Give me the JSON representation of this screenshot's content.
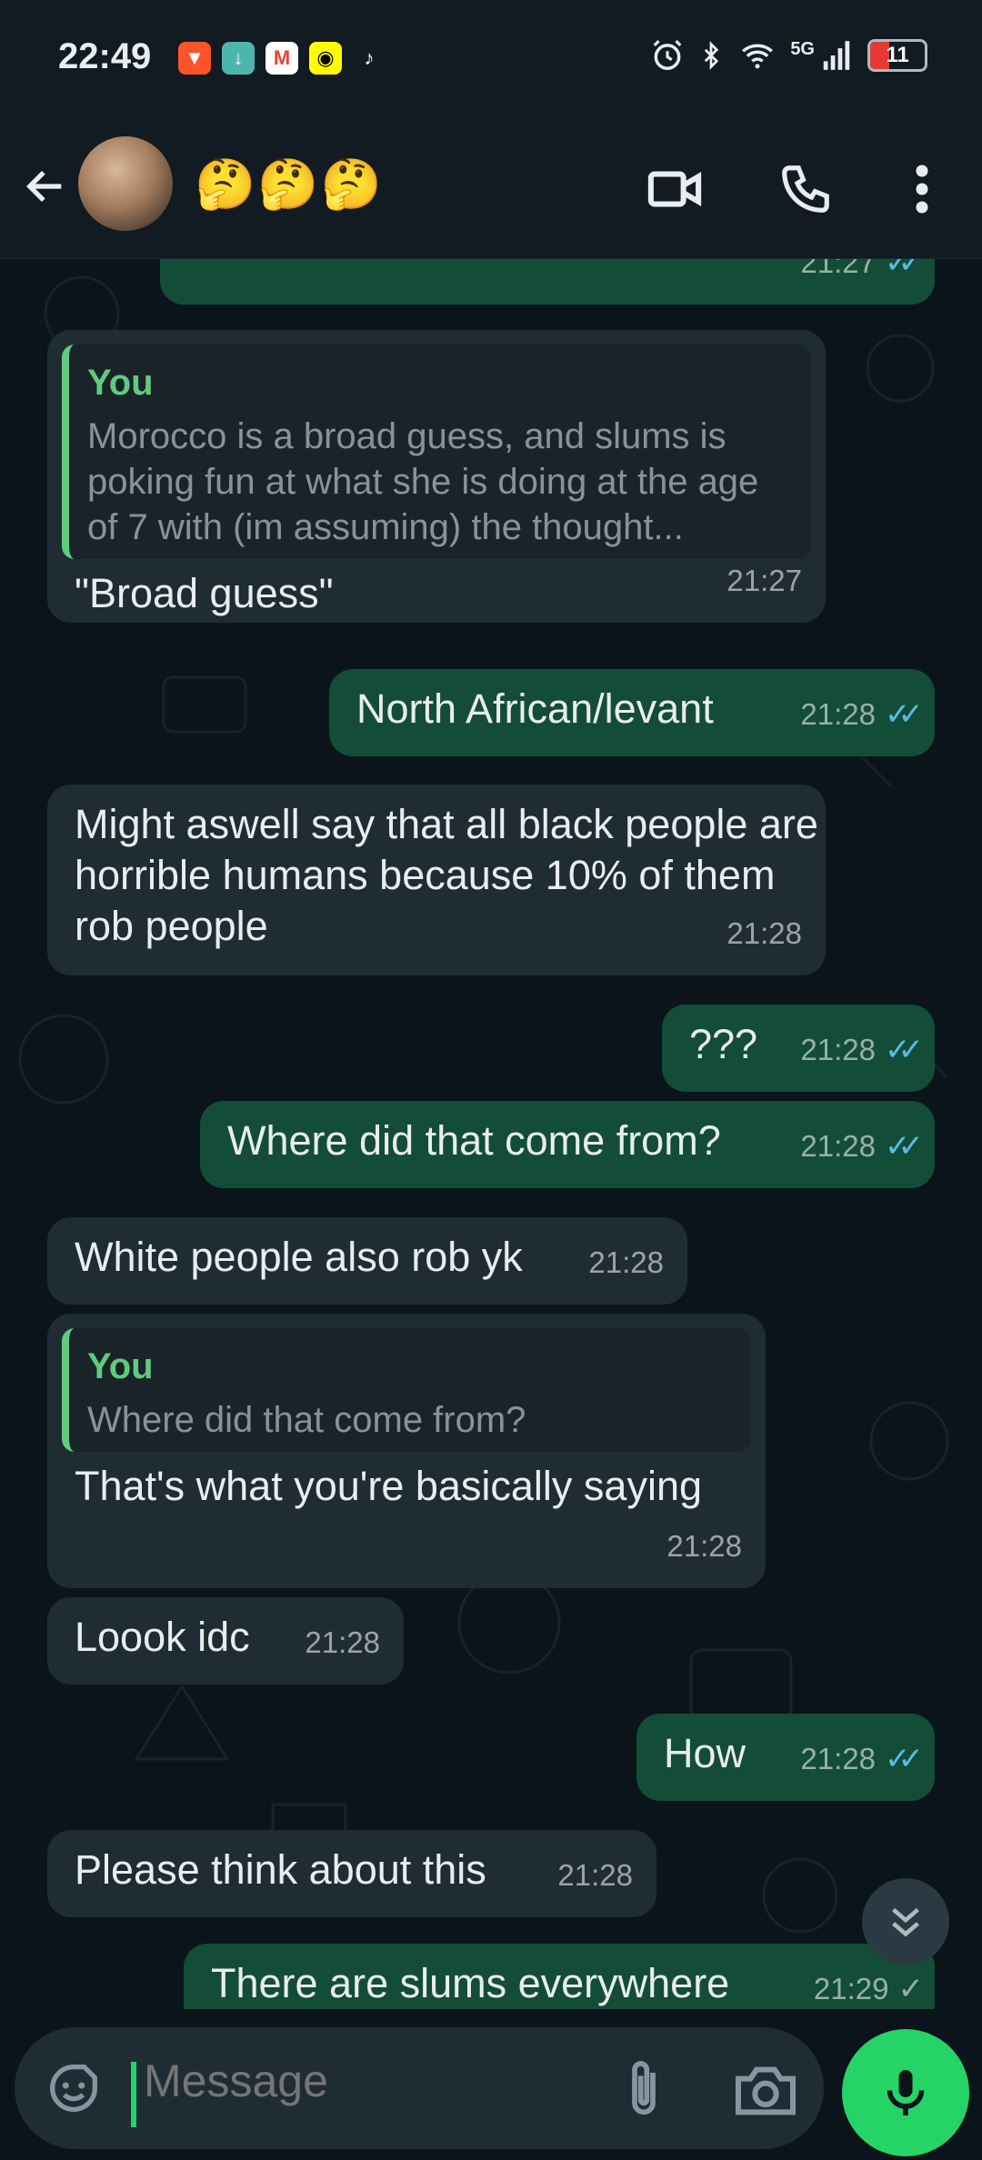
{
  "status_bar": {
    "time": "22:49",
    "notifications": [
      "brave-icon",
      "download-icon",
      "gmail-icon",
      "snapchat-icon",
      "tiktok-icon"
    ],
    "network": "5G",
    "battery": "11",
    "battery_level": 0.11
  },
  "header": {
    "contact_name": "🤔🤔🤔"
  },
  "messages": [
    {
      "dir": "out",
      "text": "",
      "time": "21:27",
      "ticks": true
    },
    {
      "dir": "in",
      "quote_author": "You",
      "quote_text": "Morocco is a broad guess, and slums is poking fun at what she is doing at the age of 7 with (im assuming) the thought...",
      "text": "\"Broad guess\"",
      "time": "21:27"
    },
    {
      "dir": "out",
      "text": "North African/levant",
      "time": "21:28",
      "ticks": true
    },
    {
      "dir": "in",
      "text": "Might aswell say that all black people are horrible humans because 10% of them rob people",
      "time": "21:28"
    },
    {
      "dir": "out",
      "text": "???",
      "time": "21:28",
      "ticks": true
    },
    {
      "dir": "out",
      "text": "Where did that come from?",
      "time": "21:28",
      "ticks": true
    },
    {
      "dir": "in",
      "text": "White people also rob yk",
      "time": "21:28"
    },
    {
      "dir": "in",
      "quote_author": "You",
      "quote_text": "Where did that come from?",
      "text": "That's what you're basically saying",
      "time": "21:28"
    },
    {
      "dir": "in",
      "text": "Loook idc",
      "time": "21:28"
    },
    {
      "dir": "out",
      "text": "How",
      "time": "21:28",
      "ticks": true
    },
    {
      "dir": "in",
      "text": "Please think about this",
      "time": "21:28"
    },
    {
      "dir": "out",
      "text": "There are slums everywhere",
      "time": "21:29",
      "ticks": true
    }
  ],
  "composer": {
    "placeholder": "Message"
  },
  "colors": {
    "incoming": "#202c33",
    "outgoing": "#134d37",
    "accent": "#25d366",
    "read_ticks": "#53bdeb"
  }
}
